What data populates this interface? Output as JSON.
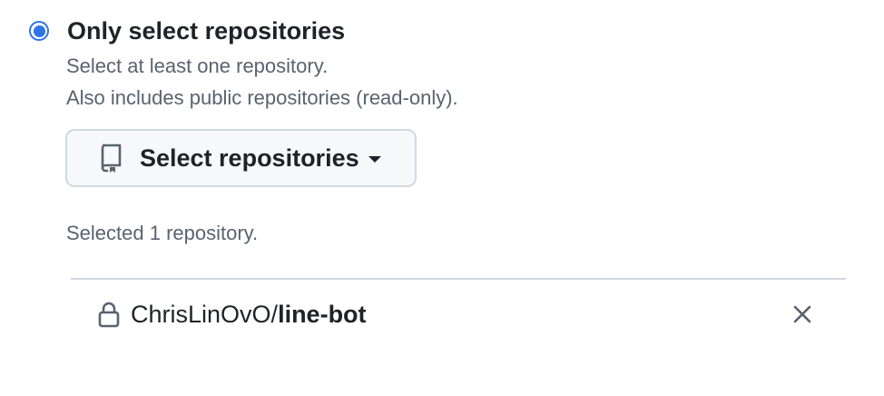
{
  "access_option": {
    "label": "Only select repositories",
    "selected": true,
    "hint_line_1": "Select at least one repository.",
    "hint_line_2": "Also includes public repositories (read-only)."
  },
  "select_button": {
    "label": "Select repositories",
    "icon": "repo-icon"
  },
  "selected_summary": "Selected 1 repository.",
  "repositories": [
    {
      "owner": "ChrisLinOvO",
      "separator": "/",
      "name": "line-bot",
      "icon": "lock-icon",
      "remove_icon": "close-icon"
    }
  ],
  "colors": {
    "accent": "#2f73e8",
    "text": "#1f2328",
    "muted": "#59636e",
    "border": "#d1d9e0",
    "button_bg": "#f6f8fa"
  }
}
